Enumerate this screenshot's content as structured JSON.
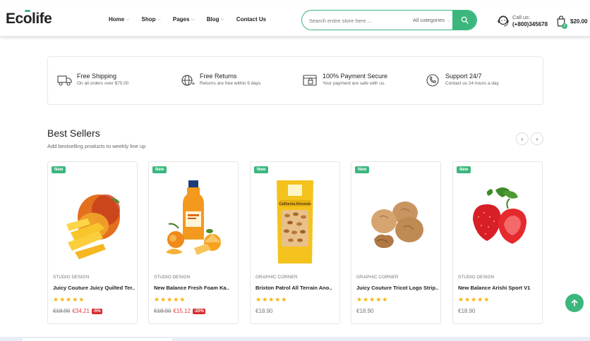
{
  "brand": {
    "logo_text_a": "Ec",
    "logo_text_b": "o",
    "logo_text_c": "life",
    "accent_color": "#3bb77e"
  },
  "nav": {
    "items": [
      {
        "label": "Home",
        "has_dropdown": true
      },
      {
        "label": "Shop",
        "has_dropdown": true
      },
      {
        "label": "Pages",
        "has_dropdown": true
      },
      {
        "label": "Blog",
        "has_dropdown": true
      },
      {
        "label": "Contact Us",
        "has_dropdown": false
      }
    ]
  },
  "search": {
    "placeholder": "Search entire store here ...",
    "category": "All categories",
    "icon": "search-icon"
  },
  "call": {
    "label": "Call us:",
    "number": "(+800)345678",
    "icon": "headset-icon"
  },
  "cart": {
    "count": "2",
    "amount": "$20.00",
    "icon": "shopping-bag-icon"
  },
  "features": [
    {
      "title": "Free Shipping",
      "sub": "On all orders over $75.00",
      "icon": "truck-icon"
    },
    {
      "title": "Free Returns",
      "sub": "Returns are free within 9 days",
      "icon": "globe-return-icon"
    },
    {
      "title": "100% Payment Secure",
      "sub": "Your payment are safe with us.",
      "icon": "secure-payment-icon"
    },
    {
      "title": "Support 24/7",
      "sub": "Contact us 24 hours a day",
      "icon": "support-phone-icon"
    }
  ],
  "best_sellers": {
    "title": "Best Sellers",
    "subtitle": "Add bestselling products to weekly line up",
    "prev": "‹",
    "next": "›",
    "products": [
      {
        "badge": "New",
        "vendor": "STUDIO DESIGN",
        "name": "Juicy Couture Juicy Quilted Ter..",
        "rating": 5,
        "old_price": "€18.90",
        "price": "€34.21",
        "discount": "-5%",
        "image": "mango"
      },
      {
        "badge": "New",
        "vendor": "STUDIO DESIGN",
        "name": "New Balance Fresh Foam Ka..",
        "rating": 5,
        "old_price": "€18.90",
        "price": "€15.12",
        "discount": "-20%",
        "image": "juice"
      },
      {
        "badge": "New",
        "vendor": "GRAPHIC CORNER",
        "name": "Brixton Patrol All Terrain Ano..",
        "rating": 5,
        "price": "€18.90",
        "image": "almonds",
        "package_text": "California Almonds"
      },
      {
        "badge": "New",
        "vendor": "GRAPHIC CORNER",
        "name": "Juicy Couture Tricot Logo Strip..",
        "rating": 5,
        "price": "€18.90",
        "image": "walnuts"
      },
      {
        "badge": "New",
        "vendor": "STUDIO DESIGN",
        "name": "New Balance Arishi Sport V1",
        "rating": 5,
        "price": "€18.90",
        "image": "strawberries"
      }
    ]
  },
  "stars_text": "★★★★★"
}
